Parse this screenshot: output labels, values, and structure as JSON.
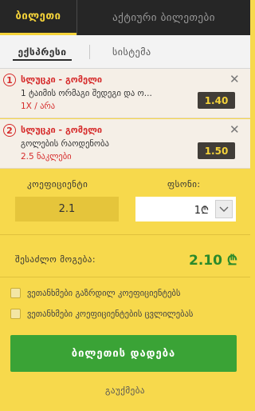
{
  "tabs": {
    "betslip": "ბილეთი",
    "active": "აქტიური ბილეთები"
  },
  "subtabs": {
    "express": "ექსპრესი",
    "system": "სისტემა"
  },
  "bets": [
    {
      "num": "1",
      "match": "სლუცკი - გომელი",
      "market": "1 ტაიმის ორმაგი შედეგი და ო...",
      "pick": "1X / არა",
      "odds": "1.40"
    },
    {
      "num": "2",
      "match": "სლუცკი - გომელი",
      "market": "გოლების რაოდენობა",
      "pick": "2.5 ნაკლები",
      "odds": "1.50"
    }
  ],
  "coef": {
    "label": "კოეფიციენტი",
    "value": "2.1"
  },
  "stake": {
    "label": "ფსონი:",
    "value": "1₾"
  },
  "win": {
    "label": "შესაძლო მოგება:",
    "value": "2.10 ₾"
  },
  "options": {
    "accept_higher": "ვეთანხმები გაზრდილ კოეფიციენტებს",
    "accept_changes": "ვეთანხმები კოეფიციენტების ცვლილებას"
  },
  "place_bet": "ბილეთის დადება",
  "cancel": "გაუქმება",
  "colors": {
    "accent": "#f5d33a",
    "dark": "#262626",
    "win": "#2b8a2b",
    "button": "#3aa336",
    "red": "#d62b2b"
  }
}
